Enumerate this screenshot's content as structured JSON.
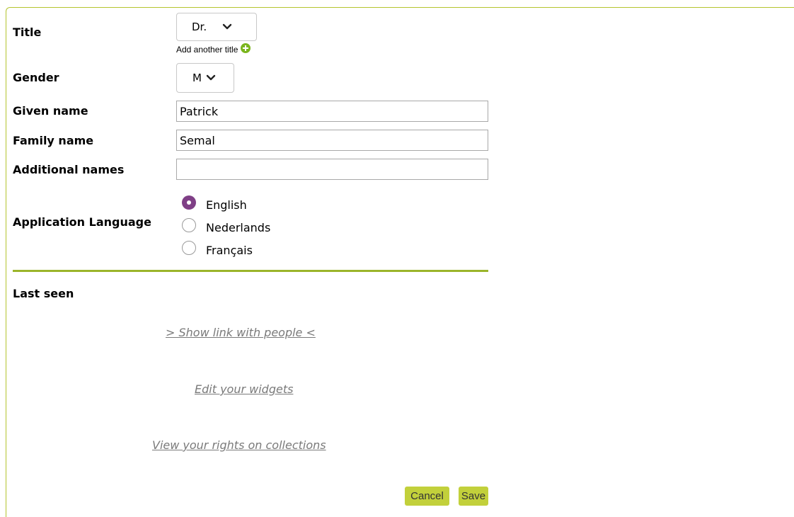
{
  "form": {
    "title_label": "Title",
    "title_value": "Dr.",
    "add_title_text": "Add another title",
    "gender_label": "Gender",
    "gender_value": "M",
    "given_name_label": "Given name",
    "given_name_value": "Patrick",
    "family_name_label": "Family name",
    "family_name_value": "Semal",
    "additional_names_label": "Additional names",
    "additional_names_value": "",
    "language_label": "Application Language",
    "languages": [
      {
        "label": "English",
        "checked": true
      },
      {
        "label": "Nederlands",
        "checked": false
      },
      {
        "label": "Français",
        "checked": false
      }
    ]
  },
  "last_seen_label": "Last seen",
  "links": {
    "show_link_people": "> Show link with people <",
    "edit_widgets": "Edit your widgets",
    "view_rights": "View your rights on collections"
  },
  "buttons": {
    "cancel": "Cancel",
    "save": "Save"
  },
  "colors": {
    "accent_green": "#9bb52b",
    "button_green": "#c2d03b",
    "radio_purple": "#7f3f86",
    "add_icon_green": "#7ab51d"
  }
}
